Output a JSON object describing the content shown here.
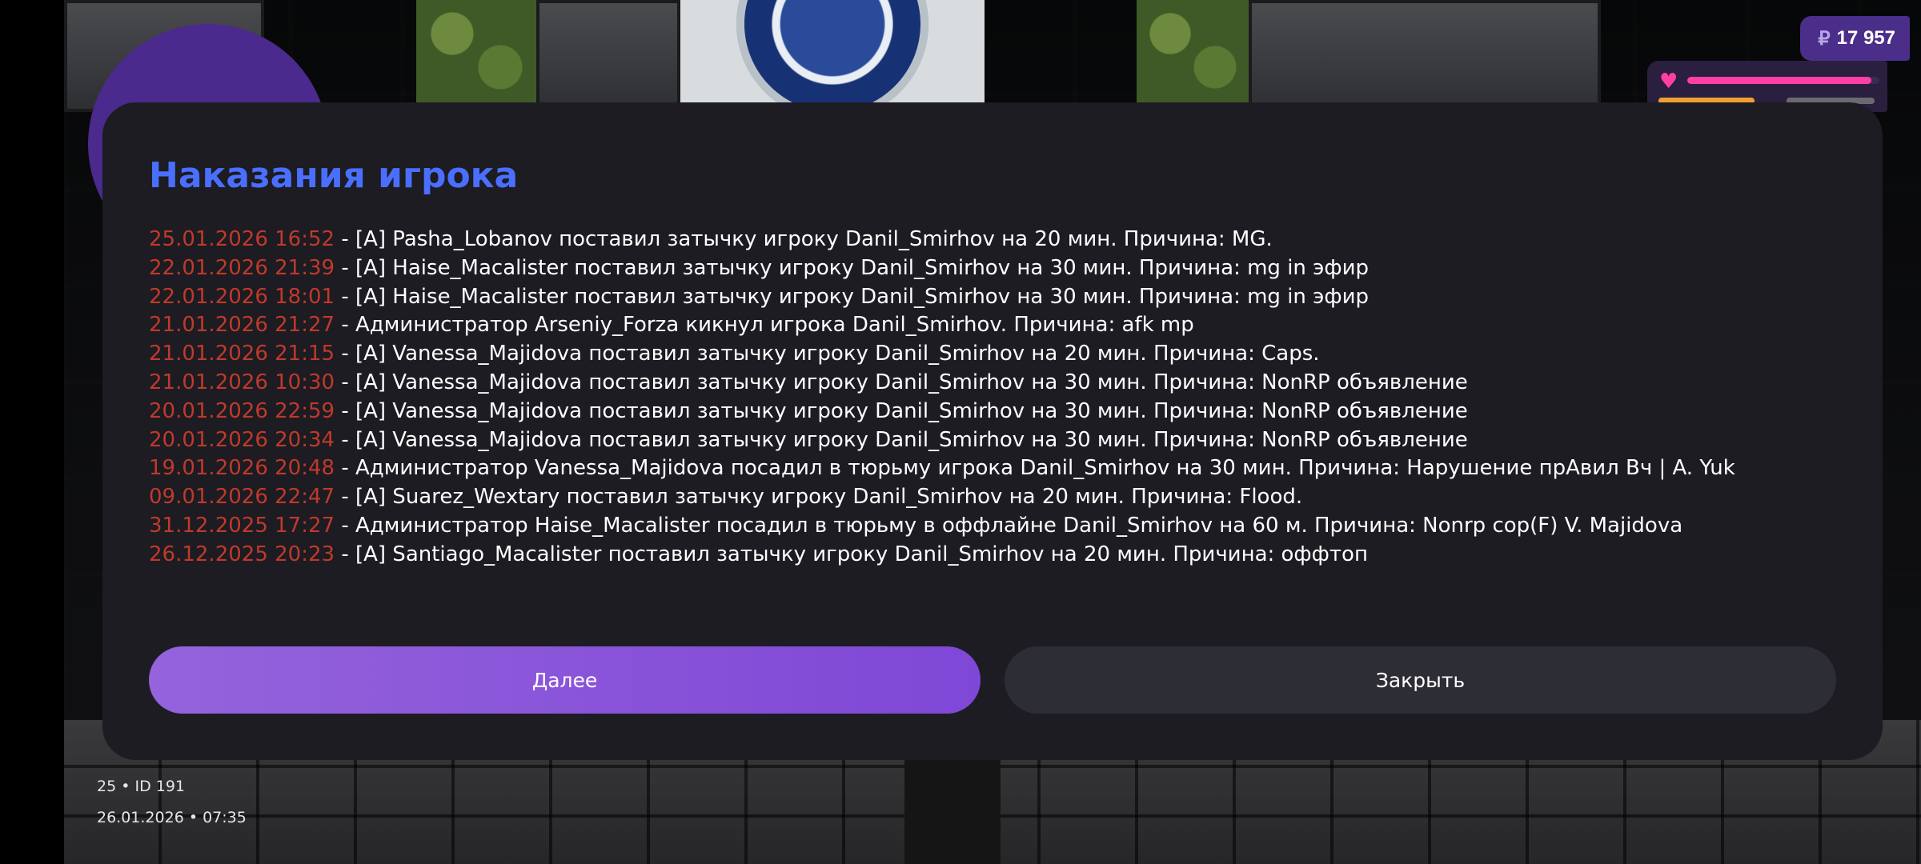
{
  "hud": {
    "currency_symbol": "₽",
    "money": "17 957",
    "health_fraction": 0.96
  },
  "modal": {
    "title": "Наказания игрока",
    "entries": [
      {
        "date": "25.01.2026 16:52",
        "text": " - [A] Pasha_Lobanov поставил затычку игроку Danil_Smirhov на 20 мин. Причина: MG."
      },
      {
        "date": "22.01.2026 21:39",
        "text": " - [A] Haise_Macalister поставил затычку игроку Danil_Smirhov на 30 мин. Причина: mg in эфир"
      },
      {
        "date": "22.01.2026 18:01",
        "text": " - [A] Haise_Macalister поставил затычку игроку Danil_Smirhov на 30 мин. Причина: mg in эфир"
      },
      {
        "date": "21.01.2026 21:27",
        "text": " - Администратор Arseniy_Forza кикнул игрока Danil_Smirhov. Причина: afk mp"
      },
      {
        "date": "21.01.2026 21:15",
        "text": " - [A] Vanessa_Majidova поставил затычку игроку Danil_Smirhov на 20 мин. Причина: Caps."
      },
      {
        "date": "21.01.2026 10:30",
        "text": " - [A] Vanessa_Majidova поставил затычку игроку Danil_Smirhov на 30 мин. Причина: NonRP объявление"
      },
      {
        "date": "20.01.2026 22:59",
        "text": " - [A] Vanessa_Majidova поставил затычку игроку Danil_Smirhov на 30 мин. Причина: NonRP объявление"
      },
      {
        "date": "20.01.2026 20:34",
        "text": " - [A] Vanessa_Majidova поставил затычку игроку Danil_Smirhov на 30 мин. Причина: NonRP объявление"
      },
      {
        "date": "19.01.2026 20:48",
        "text": " - Администратор Vanessa_Majidova посадил в тюрьму игрока Danil_Smirhov на 30 мин. Причина: Нарушение прАвил  Вч | A. Yuk"
      },
      {
        "date": "09.01.2026 22:47",
        "text": " - [A] Suarez_Wextary поставил затычку игроку Danil_Smirhov на 20 мин. Причина: Flood."
      },
      {
        "date": "31.12.2025 17:27",
        "text": " - Администратор Haise_Macalister посадил в тюрьму в оффлайне Danil_Smirhov на 60 м. Причина: Nonrp cop(F) V. Majidova"
      },
      {
        "date": "26.12.2025 20:23",
        "text": " - [A] Santiago_Macalister поставил затычку игроку Danil_Smirhov на 20 мин. Причина: оффтоп"
      }
    ],
    "next_label": "Далее",
    "close_label": "Закрыть"
  },
  "footer": {
    "player_info": "25 • ID 191",
    "datetime": "26.01.2026 • 07:35"
  }
}
